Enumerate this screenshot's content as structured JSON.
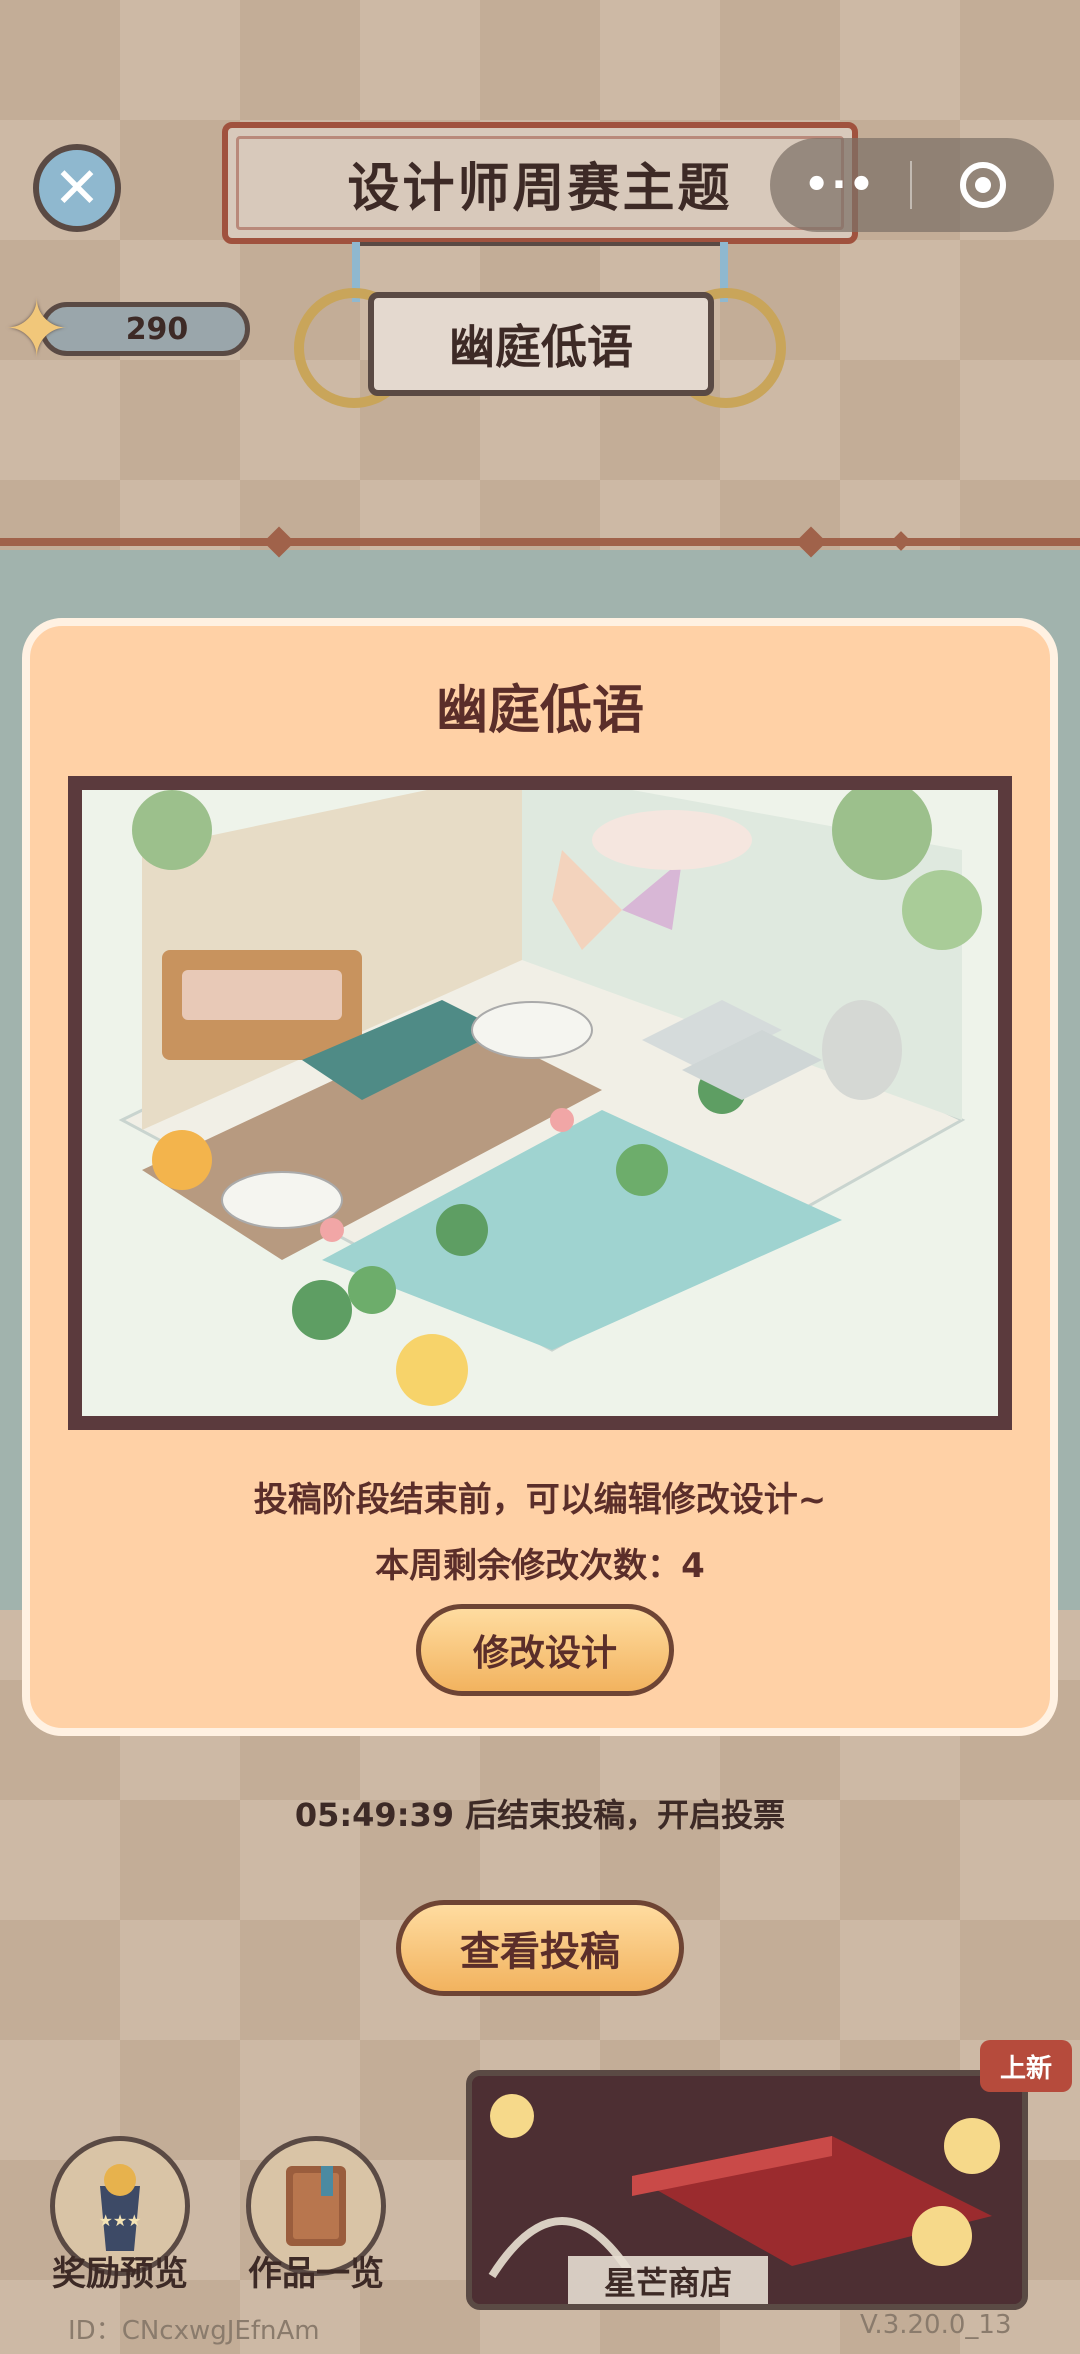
{
  "header": {
    "title": "设计师周赛主题",
    "theme_name": "幽庭低语",
    "menu_dots": "•·•",
    "star_count": "290"
  },
  "modal": {
    "title": "幽庭低语",
    "text_line1": "投稿阶段结束前，可以编辑修改设计~",
    "text_line2": "本周剩余修改次数：4",
    "modify_button": "修改设计"
  },
  "countdown": {
    "time": "05:49:39",
    "suffix": "后结束投稿，开启投票"
  },
  "view_button": "查看投稿",
  "bottom": {
    "rewards_label": "奖励预览",
    "works_label": "作品一览",
    "store_label": "星芒商店",
    "new_badge": "上新"
  },
  "footer": {
    "id": "ID：CNcxwgJEfnAm",
    "version": "V.3.20.0_13"
  },
  "colors": {
    "accent": "#a0523e",
    "panel": "#ffd1a6",
    "button": "#f2b35f"
  }
}
